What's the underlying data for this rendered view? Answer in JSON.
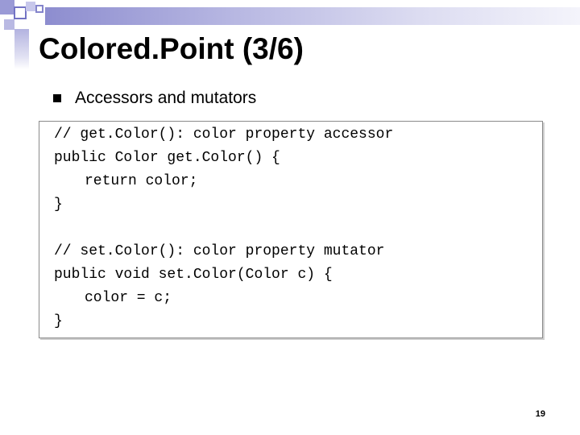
{
  "slide": {
    "title": "Colored.Point (3/6)",
    "bullet": "Accessors and mutators",
    "page_number": "19"
  },
  "code": {
    "line1": "// get.Color(): color property accessor",
    "line2": "public Color get.Color() {",
    "line3": "return color;",
    "line4": "}",
    "line5": "// set.Color(): color property mutator",
    "line6": "public void set.Color(Color c) {",
    "line7": "color = c;",
    "line8": "}"
  },
  "colors": {
    "accent_dark": "#8d8dcf",
    "accent_light": "#dcdcf1",
    "text": "#000000",
    "background": "#ffffff"
  }
}
